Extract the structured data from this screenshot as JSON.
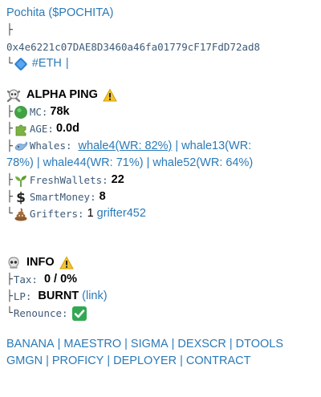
{
  "token": {
    "name_link": "Pochita ($POCHITA)",
    "tree_top": "├",
    "address": "0x4e6221c07DAE8D3460a46fa01779cF17FdD72ad8",
    "chain": "#ETH",
    "chain_sep": "|"
  },
  "alpha": {
    "title": "ALPHA PING",
    "mc_label": "MC:",
    "mc_value": "78k",
    "age_label": "AGE:",
    "age_value": "0.0d",
    "whales_label": "Whales:",
    "whales": [
      "whale4(WR: 82%)",
      "whale13(WR: 78%)",
      "whale44(WR: 71%)",
      "whale52(WR: 64%)"
    ],
    "freshwallets_label": "FreshWallets:",
    "freshwallets_value": "22",
    "smartmoney_label": "SmartMoney:",
    "smartmoney_value": "8",
    "grifters_label": "Grifters:",
    "grifters_count": "1",
    "grifters_link": "grifter452"
  },
  "info": {
    "title": "INFO",
    "tax_label": "Tax:",
    "tax_value": "0 / 0%",
    "lp_label": "LP:",
    "lp_value": "BURNT",
    "lp_link": "(link)",
    "renounce_label": "Renounce:"
  },
  "footer_links_row1": [
    "BANANA",
    "MAESTRO",
    "SIGMA",
    "DEXSCR",
    "DTOOLS"
  ],
  "footer_links_row2": [
    "GMGN",
    "PROFICY",
    "DEPLOYER",
    "CONTRACT"
  ],
  "icons": {
    "chain": "blue-diamond-icon",
    "alpha": "skull-crossbones-icon",
    "warning": "warning-icon",
    "mc": "green-circle-icon",
    "age": "puzzle-piece-icon",
    "whales": "whale-icon",
    "fresh": "seedling-icon",
    "smart": "dollar-sign-icon",
    "grifters": "poop-icon",
    "info": "skull-icon",
    "renounce": "check-mark-button-icon"
  },
  "colors": {
    "link": "#2a7ab8",
    "mono": "#3d5a78",
    "check": "#33a852",
    "warning": "#f4c430"
  }
}
